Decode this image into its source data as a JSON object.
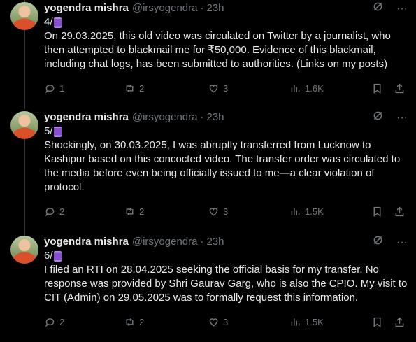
{
  "tweets": [
    {
      "author": "yogendra mishra",
      "handle": "@irsyogendra",
      "time": "23h",
      "number": "4/",
      "text": "On 29.03.2025, this old video was circulated on Twitter by a journalist, who then attempted to blackmail me for ₹50,000. Evidence of this blackmail, including chat logs, has been submitted to authorities. (Links on my posts)",
      "replies": "1",
      "reposts": "2",
      "likes": "3",
      "views": "1.6K"
    },
    {
      "author": "yogendra mishra",
      "handle": "@irsyogendra",
      "time": "23h",
      "number": "5/",
      "text": "Shockingly, on 30.03.2025, I was abruptly transferred from Lucknow to Kashipur based on this concocted video. The transfer order was circulated to the media before even being officially issued to me—a clear violation of protocol.",
      "replies": "2",
      "reposts": "2",
      "likes": "3",
      "views": "1.5K"
    },
    {
      "author": "yogendra mishra",
      "handle": "@irsyogendra",
      "time": "23h",
      "number": "6/",
      "text": "I filed an RTI on 28.04.2025 seeking the official basis for my transfer. No response was provided by Shri Gaurav Garg, who is also the CPIO. My visit to CIT (Admin) on 29.05.2025 was to formally request this information.",
      "replies": "2",
      "reposts": "2",
      "likes": "3",
      "views": "1.5K"
    }
  ],
  "icons": {
    "grok": "grok-icon",
    "more": "more-icon",
    "reply": "reply-icon",
    "repost": "repost-icon",
    "like": "heart-icon",
    "views": "views-icon",
    "bookmark": "bookmark-icon",
    "share": "share-icon",
    "thread_emoji": "thread-spool-icon"
  },
  "colors": {
    "background": "#000000",
    "text": "#e7e9ea",
    "secondary": "#71767b",
    "connector": "#333639"
  }
}
